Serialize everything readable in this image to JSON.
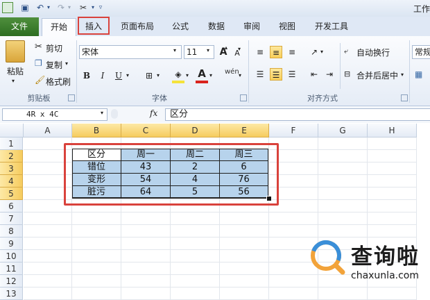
{
  "title_bar": {
    "window_title": "工作"
  },
  "quick_access": {
    "save_icon": "save-icon",
    "undo_icon": "undo-icon",
    "redo_icon": "redo-icon",
    "customize_icon": "tools-icon"
  },
  "tabs": [
    {
      "label": "文件"
    },
    {
      "label": "开始"
    },
    {
      "label": "插入"
    },
    {
      "label": "页面布局"
    },
    {
      "label": "公式"
    },
    {
      "label": "数据"
    },
    {
      "label": "审阅"
    },
    {
      "label": "视图"
    },
    {
      "label": "开发工具"
    }
  ],
  "clipboard": {
    "paste_label": "粘贴",
    "cut_label": "剪切",
    "copy_label": "复制",
    "format_painter_label": "格式刷",
    "group_label": "剪贴板"
  },
  "font": {
    "font_name": "宋体",
    "font_size": "11",
    "grow_label": "A",
    "shrink_label": "A",
    "bold_label": "B",
    "italic_label": "I",
    "underline_label": "U",
    "font_color_label": "A",
    "phonetic_label": "wén",
    "group_label": "字体",
    "colors": {
      "highlight": "#f5e33b",
      "font_color": "#d9231d"
    }
  },
  "alignment": {
    "wrap_label": "自动换行",
    "merge_label": "合并后居中",
    "group_label": "对齐方式"
  },
  "number": {
    "format_label": "常规"
  },
  "formula_bar": {
    "name_box": "4R x 4C",
    "fx_label": "fx",
    "formula": "区分"
  },
  "columns": [
    "A",
    "B",
    "C",
    "D",
    "E",
    "F",
    "G",
    "H"
  ],
  "rows": [
    "1",
    "2",
    "3",
    "4",
    "5",
    "6",
    "7",
    "8",
    "9",
    "10",
    "11",
    "12",
    "13"
  ],
  "table": {
    "headers": [
      "区分",
      "周一",
      "周二",
      "周三"
    ],
    "rows": [
      [
        "错位",
        "43",
        "2",
        "6"
      ],
      [
        "变形",
        "54",
        "4",
        "76"
      ],
      [
        "脏污",
        "64",
        "5",
        "56"
      ]
    ]
  },
  "watermark": {
    "brand": "查询啦",
    "url": "chaxunla.com"
  },
  "accent_colors": {
    "highlight_box": "#d9423c",
    "file_tab": "#2d6e22",
    "table_fill": "#b7d3ec"
  }
}
